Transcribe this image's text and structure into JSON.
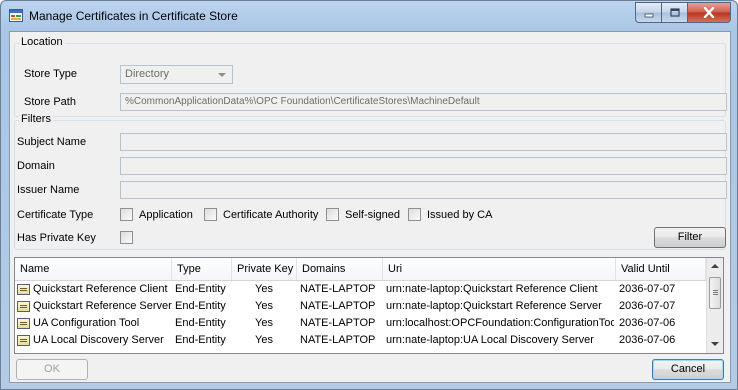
{
  "window": {
    "title": "Manage Certificates in Certificate Store",
    "colors": {
      "accent": "#3c7fb1",
      "close": "#c94a36",
      "frame": "#a9c6e6"
    }
  },
  "location": {
    "legend": "Location",
    "store_type_label": "Store Type",
    "store_type_value": "Directory",
    "store_path_label": "Store Path",
    "store_path_value": "%CommonApplicationData%\\OPC Foundation\\CertificateStores\\MachineDefault"
  },
  "filters": {
    "legend": "Filters",
    "subject_name_label": "Subject Name",
    "subject_name_value": "",
    "domain_label": "Domain",
    "domain_value": "",
    "issuer_name_label": "Issuer Name",
    "issuer_name_value": "",
    "certificate_type_label": "Certificate Type",
    "types": [
      {
        "label": "Application",
        "checked": false
      },
      {
        "label": "Certificate Authority",
        "checked": false
      },
      {
        "label": "Self-signed",
        "checked": false
      },
      {
        "label": "Issued by CA",
        "checked": false
      }
    ],
    "has_private_key_label": "Has Private Key",
    "filter_button": "Filter"
  },
  "certificates": {
    "columns": [
      "Name",
      "Type",
      "Private Key",
      "Domains",
      "Uri",
      "Valid Until"
    ],
    "rows": [
      {
        "name": "Quickstart Reference Client",
        "type": "End-Entity",
        "private_key": "Yes",
        "domains": "NATE-LAPTOP",
        "uri": "urn:nate-laptop:Quickstart Reference Client",
        "valid_until": "2036-07-07"
      },
      {
        "name": "Quickstart Reference Server",
        "type": "End-Entity",
        "private_key": "Yes",
        "domains": "NATE-LAPTOP",
        "uri": "urn:nate-laptop:Quickstart Reference Server",
        "valid_until": "2036-07-07"
      },
      {
        "name": "UA Configuration Tool",
        "type": "End-Entity",
        "private_key": "Yes",
        "domains": "NATE-LAPTOP",
        "uri": "urn:localhost:OPCFoundation:ConfigurationTool",
        "valid_until": "2036-07-06"
      },
      {
        "name": "UA Local Discovery Server",
        "type": "End-Entity",
        "private_key": "Yes",
        "domains": "NATE-LAPTOP",
        "uri": "urn:nate-laptop:UA Local Discovery Server",
        "valid_until": "2036-07-06"
      }
    ]
  },
  "footer": {
    "ok_button": "OK",
    "cancel_button": "Cancel"
  },
  "icons": [
    "app-icon",
    "minimize-icon",
    "maximize-icon",
    "close-icon",
    "certificate-icon",
    "scroll-up-icon",
    "scroll-down-icon"
  ]
}
